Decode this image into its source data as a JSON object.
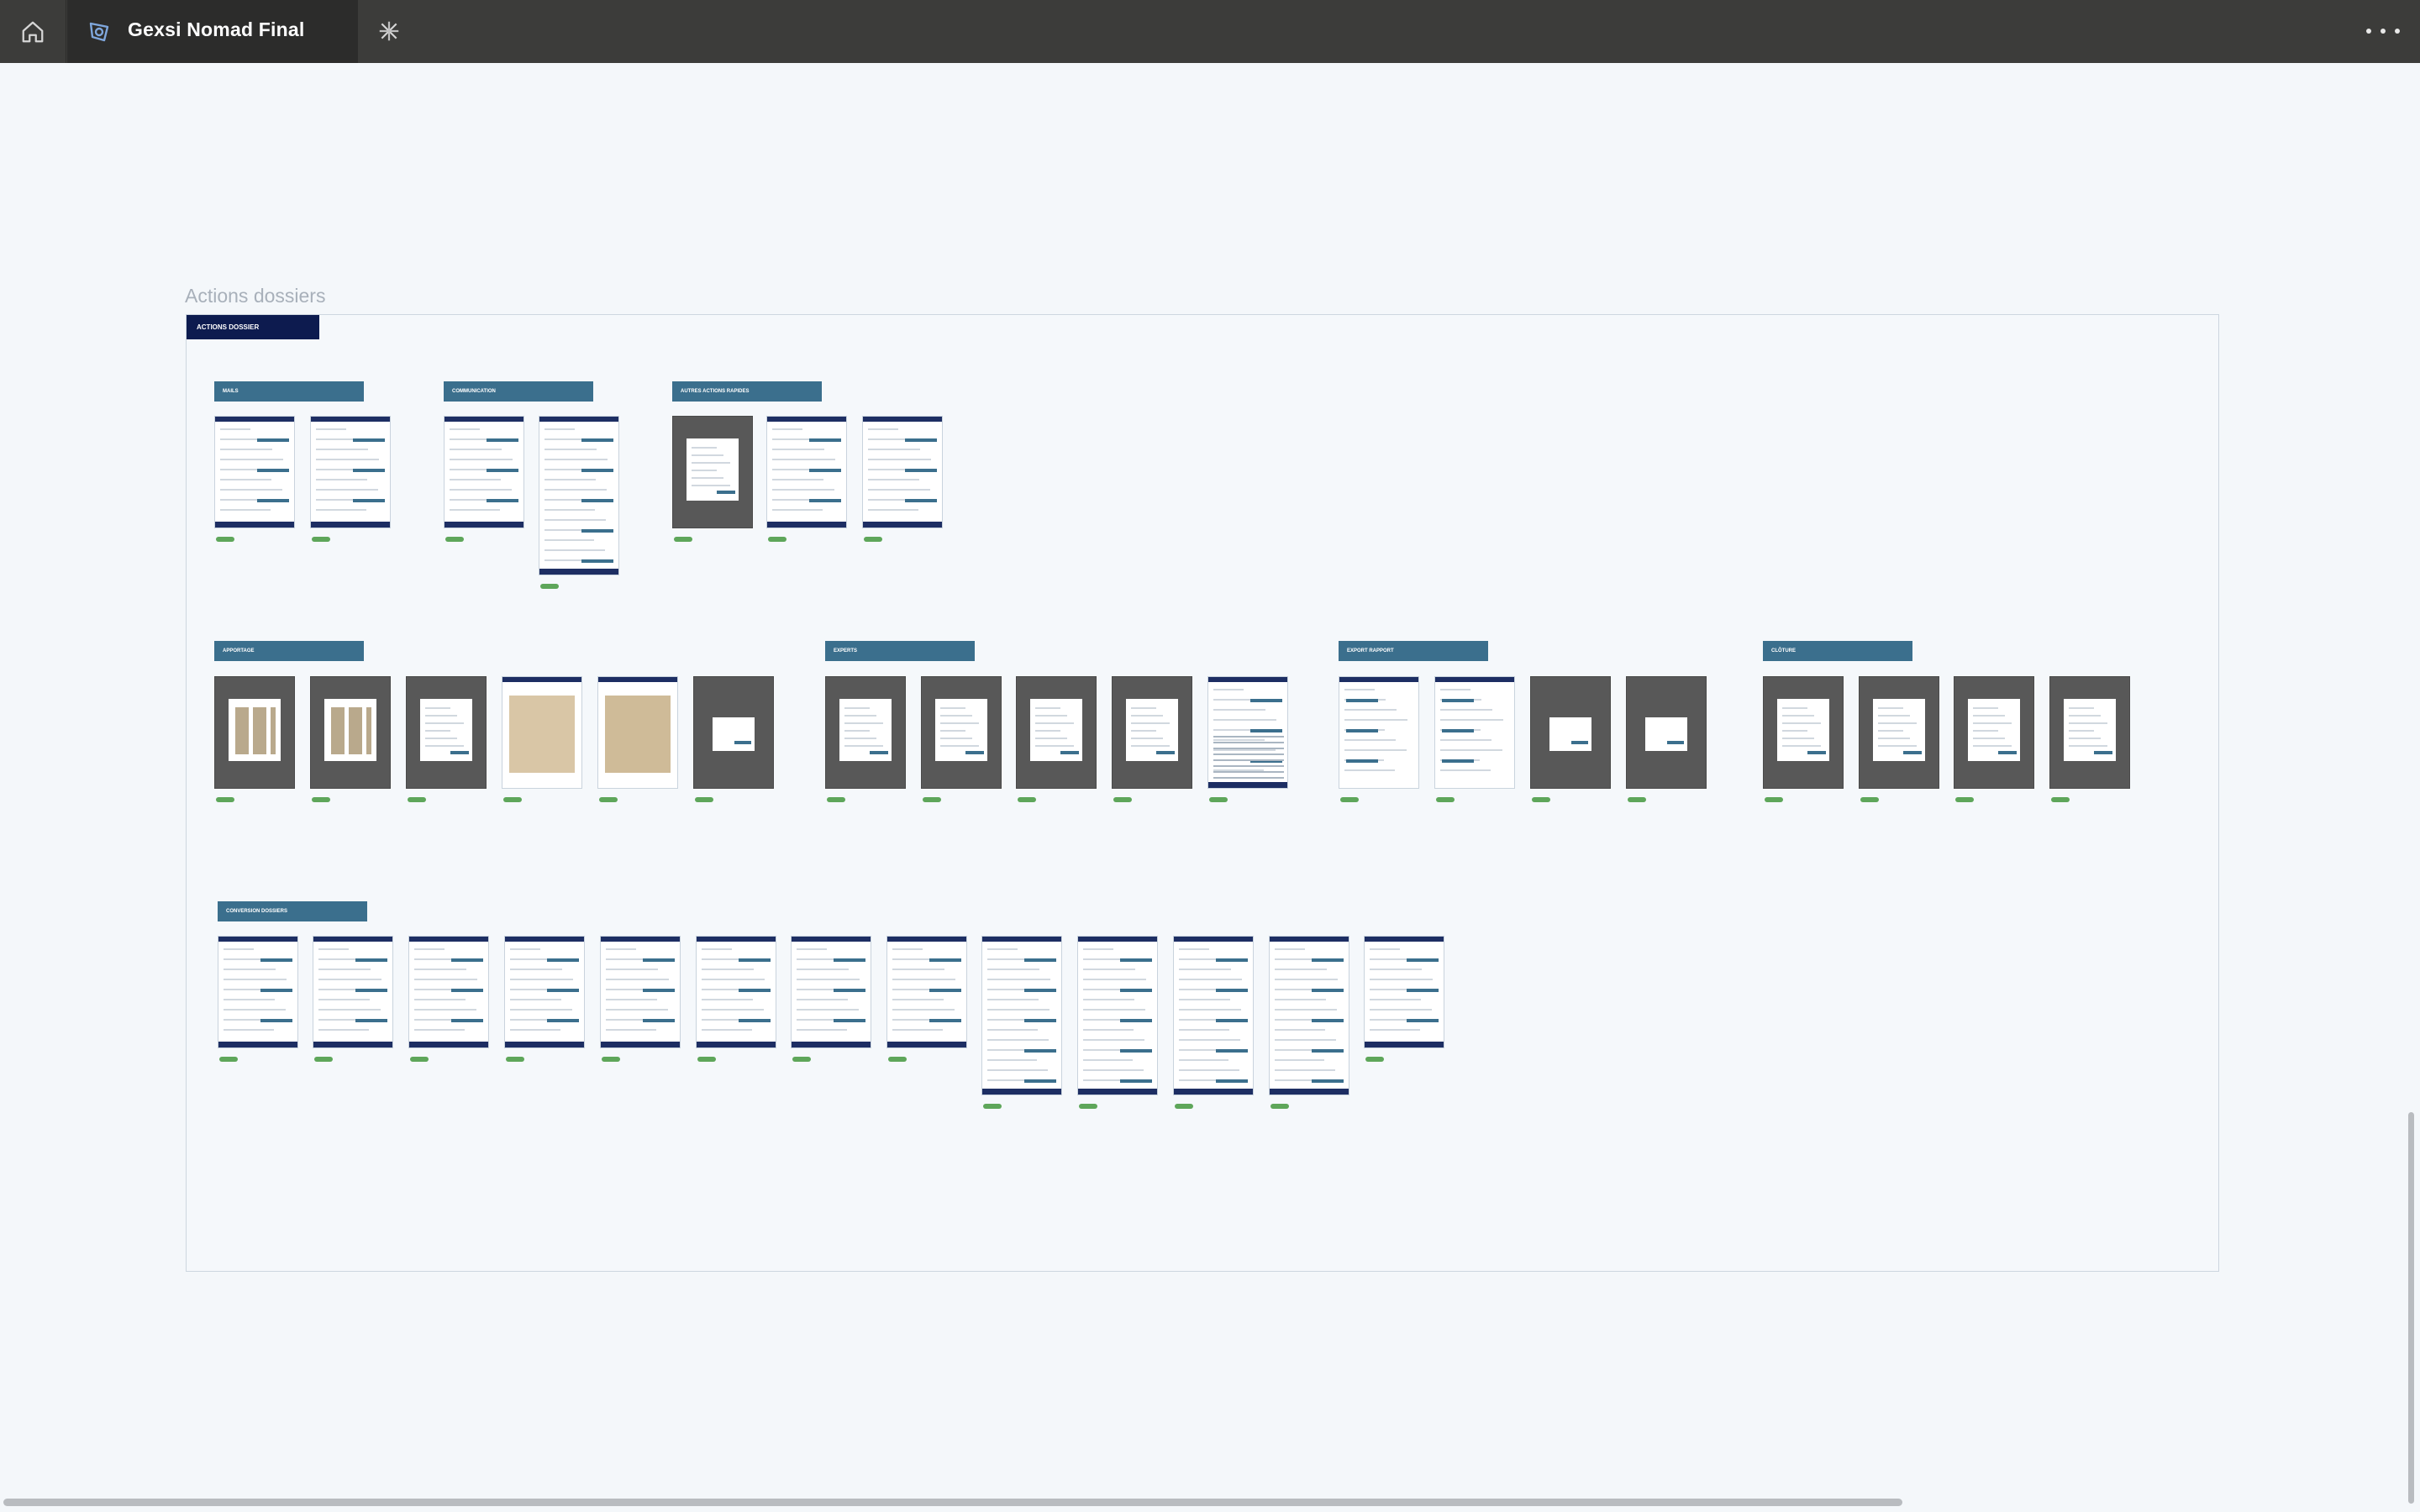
{
  "app": {
    "tab_title": "Gexsi Nomad Final",
    "icons": {
      "home": "home-icon",
      "tab": "gexsi-logo-icon",
      "close": "close-icon",
      "new_tab": "plus-icon",
      "more": "more-horizontal-icon"
    }
  },
  "canvas": {
    "section_label": "Actions dossiers",
    "board_title": "ACTIONS DOSSIER",
    "groups": [
      {
        "label": "MAILS"
      },
      {
        "label": "COMMUNICATION"
      },
      {
        "label": "AUTRES ACTIONS RAPIDES"
      },
      {
        "label": "APPORTAGE"
      },
      {
        "label": "EXPERTS"
      },
      {
        "label": "EXPORT RAPPORT"
      },
      {
        "label": "CLÔTURE"
      },
      {
        "label": "CONVERSION DOSSIERS"
      }
    ]
  },
  "colors": {
    "topbar": "#3c3c3a",
    "tab_active": "#2c2c2b",
    "canvas_bg": "#f4f7fa",
    "board_title_bg": "#0d1b4f",
    "group_label_bg": "#3b6f8d",
    "status_pill": "#5ea65a"
  }
}
